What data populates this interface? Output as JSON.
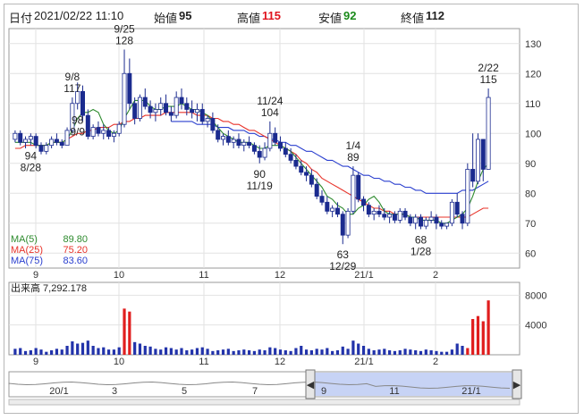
{
  "info": {
    "date_label": "日付",
    "date_value": "2021/02/22 11:10",
    "open_label": "始値",
    "open_value": "95",
    "high_label": "高値",
    "high_value": "115",
    "low_label": "安値",
    "low_value": "92",
    "close_label": "終値",
    "close_value": "112"
  },
  "colors": {
    "up": "#ffffff",
    "down": "#1b2b8f",
    "high": "#e0141e",
    "low": "#1a8a1a",
    "ma5": "#2e8b2e",
    "ma25": "#e8332a",
    "ma75": "#2a3fcf",
    "volume": "#2233aa",
    "volume_recent": "#e01e1e"
  },
  "legend": [
    {
      "name": "MA(5)",
      "value": "89.80",
      "color": "#2e8b2e"
    },
    {
      "name": "MA(25)",
      "value": "75.20",
      "color": "#e8332a"
    },
    {
      "name": "MA(75)",
      "value": "83.60",
      "color": "#2a3fcf"
    }
  ],
  "volume_label": "出来高",
  "volume_value": "7,292.178",
  "chart_data": [
    {
      "type": "candlestick",
      "y_ticks": [
        60,
        70,
        80,
        90,
        100,
        110,
        120,
        130
      ],
      "ylim": [
        55,
        135
      ],
      "x_ticks": [
        "9",
        "10",
        "11",
        "12",
        "21/1",
        "2"
      ],
      "annotations": [
        {
          "date": "8/28",
          "value": "94"
        },
        {
          "date": "9/8",
          "value": "117"
        },
        {
          "date": "9/9",
          "value": "98"
        },
        {
          "date": "9/25",
          "value": "128"
        },
        {
          "date": "11/24",
          "value": "104"
        },
        {
          "date": "11/19",
          "value": "90"
        },
        {
          "date": "1/4",
          "value": "89"
        },
        {
          "date": "12/29",
          "value": "63"
        },
        {
          "date": "1/28",
          "value": "68"
        },
        {
          "date": "2/22",
          "value": "115"
        }
      ],
      "ohlc": [
        [
          98,
          101,
          97,
          100
        ],
        [
          100,
          101,
          96,
          97
        ],
        [
          97,
          99,
          95,
          98
        ],
        [
          98,
          100,
          96,
          99
        ],
        [
          99,
          100,
          95,
          96
        ],
        [
          96,
          97,
          93,
          94
        ],
        [
          94,
          97,
          93,
          96
        ],
        [
          96,
          99,
          95,
          98
        ],
        [
          98,
          100,
          96,
          97
        ],
        [
          97,
          98,
          95,
          96
        ],
        [
          96,
          102,
          96,
          101
        ],
        [
          101,
          112,
          100,
          110
        ],
        [
          110,
          117,
          108,
          114
        ],
        [
          114,
          116,
          104,
          106
        ],
        [
          106,
          108,
          98,
          99
        ],
        [
          99,
          103,
          98,
          102
        ],
        [
          102,
          104,
          99,
          100
        ],
        [
          100,
          103,
          98,
          101
        ],
        [
          101,
          102,
          98,
          99
        ],
        [
          99,
          101,
          97,
          100
        ],
        [
          100,
          104,
          99,
          103
        ],
        [
          103,
          128,
          102,
          120
        ],
        [
          120,
          125,
          108,
          110
        ],
        [
          110,
          112,
          103,
          105
        ],
        [
          105,
          113,
          104,
          112
        ],
        [
          112,
          115,
          108,
          109
        ],
        [
          109,
          111,
          105,
          107
        ],
        [
          107,
          110,
          104,
          108
        ],
        [
          108,
          112,
          106,
          110
        ],
        [
          110,
          113,
          106,
          107
        ],
        [
          107,
          109,
          104,
          106
        ],
        [
          106,
          114,
          105,
          112
        ],
        [
          112,
          115,
          108,
          110
        ],
        [
          110,
          112,
          106,
          108
        ],
        [
          108,
          111,
          105,
          107
        ],
        [
          107,
          110,
          104,
          108
        ],
        [
          108,
          110,
          103,
          104
        ],
        [
          104,
          106,
          102,
          105
        ],
        [
          105,
          107,
          100,
          101
        ],
        [
          101,
          103,
          97,
          98
        ],
        [
          98,
          100,
          96,
          99
        ],
        [
          99,
          101,
          96,
          97
        ],
        [
          97,
          99,
          95,
          98
        ],
        [
          98,
          100,
          95,
          96
        ],
        [
          96,
          98,
          94,
          97
        ],
        [
          97,
          99,
          95,
          96
        ],
        [
          96,
          97,
          93,
          94
        ],
        [
          94,
          96,
          90,
          92
        ],
        [
          92,
          97,
          91,
          95
        ],
        [
          95,
          104,
          94,
          100
        ],
        [
          100,
          102,
          96,
          97
        ],
        [
          97,
          99,
          94,
          95
        ],
        [
          95,
          97,
          92,
          93
        ],
        [
          93,
          95,
          90,
          91
        ],
        [
          91,
          93,
          88,
          89
        ],
        [
          89,
          91,
          86,
          87
        ],
        [
          87,
          89,
          84,
          86
        ],
        [
          86,
          88,
          82,
          83
        ],
        [
          83,
          85,
          78,
          79
        ],
        [
          79,
          81,
          76,
          77
        ],
        [
          77,
          79,
          73,
          74
        ],
        [
          74,
          76,
          72,
          75
        ],
        [
          75,
          77,
          72,
          73
        ],
        [
          73,
          74,
          63,
          66
        ],
        [
          66,
          75,
          65,
          74
        ],
        [
          74,
          89,
          73,
          86
        ],
        [
          86,
          87,
          77,
          78
        ],
        [
          78,
          79,
          74,
          76
        ],
        [
          76,
          77,
          72,
          73
        ],
        [
          73,
          75,
          71,
          74
        ],
        [
          74,
          76,
          72,
          73
        ],
        [
          73,
          75,
          71,
          72
        ],
        [
          72,
          74,
          70,
          73
        ],
        [
          73,
          74,
          70,
          71
        ],
        [
          71,
          75,
          70,
          74
        ],
        [
          74,
          75,
          71,
          72
        ],
        [
          72,
          73,
          69,
          70
        ],
        [
          70,
          73,
          68,
          72
        ],
        [
          72,
          73,
          68,
          69
        ],
        [
          69,
          72,
          68,
          71
        ],
        [
          71,
          74,
          70,
          72
        ],
        [
          72,
          73,
          68,
          70
        ],
        [
          70,
          71,
          68,
          69
        ],
        [
          69,
          70,
          68,
          70
        ],
        [
          70,
          78,
          69,
          77
        ],
        [
          77,
          80,
          72,
          73
        ],
        [
          73,
          74,
          68,
          70
        ],
        [
          70,
          90,
          69,
          88
        ],
        [
          88,
          100,
          82,
          84
        ],
        [
          84,
          100,
          83,
          98
        ],
        [
          98,
          96,
          84,
          88
        ],
        [
          88,
          115,
          92,
          112
        ]
      ],
      "ma5": [
        97,
        97,
        97,
        97,
        96,
        96,
        96,
        97,
        97,
        97,
        98,
        101,
        105,
        107,
        107,
        108,
        107,
        103,
        101,
        100,
        101,
        105,
        108,
        111,
        111,
        111,
        109,
        108,
        108,
        109,
        109,
        109,
        110,
        109,
        108,
        108,
        107,
        106,
        104,
        102,
        100,
        99,
        98,
        97,
        97,
        97,
        96,
        95,
        95,
        96,
        96,
        96,
        95,
        94,
        92,
        90,
        88,
        86,
        84,
        82,
        79,
        78,
        76,
        75,
        73,
        73,
        75,
        76,
        78,
        79,
        77,
        74,
        73,
        73,
        73,
        73,
        72,
        72,
        71,
        71,
        71,
        71,
        70,
        70,
        71,
        72,
        73,
        75,
        79,
        84,
        88,
        90
      ],
      "ma25": [
        95,
        95,
        96,
        96,
        96,
        96,
        96,
        97,
        97,
        97,
        98,
        99,
        100,
        100,
        101,
        101,
        102,
        102,
        102,
        103,
        103,
        104,
        104,
        105,
        105,
        106,
        106,
        106,
        106,
        107,
        107,
        107,
        107,
        107,
        107,
        106,
        106,
        106,
        105,
        105,
        104,
        104,
        103,
        103,
        102,
        101,
        101,
        100,
        99,
        98,
        97,
        96,
        95,
        94,
        93,
        91,
        90,
        88,
        87,
        85,
        84,
        83,
        82,
        81,
        80,
        79,
        78,
        77,
        76,
        75,
        75,
        74,
        74,
        73,
        73,
        73,
        72,
        72,
        72,
        72,
        72,
        72,
        72,
        72,
        72,
        72,
        72,
        72,
        73,
        74,
        75,
        75
      ],
      "ma75": [
        null,
        null,
        null,
        null,
        null,
        null,
        null,
        null,
        null,
        null,
        null,
        null,
        null,
        null,
        null,
        null,
        null,
        null,
        null,
        null,
        null,
        null,
        null,
        null,
        null,
        null,
        null,
        null,
        null,
        null,
        104,
        104,
        104,
        104,
        104,
        103,
        103,
        103,
        103,
        102,
        102,
        102,
        101,
        101,
        101,
        100,
        100,
        99,
        99,
        98,
        98,
        97,
        97,
        96,
        96,
        95,
        94,
        94,
        93,
        92,
        91,
        91,
        90,
        89,
        89,
        88,
        87,
        86,
        86,
        85,
        85,
        84,
        84,
        83,
        83,
        82,
        82,
        81,
        81,
        80,
        80,
        80,
        80,
        80,
        80,
        80,
        81,
        81,
        81,
        82,
        83,
        84
      ],
      "volume": [
        800,
        900,
        500,
        600,
        900,
        700,
        400,
        600,
        800,
        700,
        1200,
        1800,
        1500,
        1600,
        1900,
        1200,
        900,
        1000,
        700,
        700,
        1000,
        6200,
        5800,
        1700,
        1500,
        1200,
        1100,
        800,
        700,
        1000,
        900,
        700,
        900,
        600,
        700,
        900,
        1000,
        800,
        500,
        600,
        700,
        800,
        500,
        600,
        700,
        600,
        500,
        700,
        600,
        1000,
        900,
        700,
        600,
        500,
        900,
        1200,
        700,
        600,
        800,
        700,
        900,
        500,
        600,
        1100,
        800,
        1900,
        1500,
        1200,
        800,
        600,
        700,
        800,
        600,
        500,
        600,
        800,
        700,
        600,
        500,
        700,
        600,
        500,
        400,
        400,
        700,
        1500,
        1200,
        900,
        4800,
        5200,
        4500,
        7300
      ],
      "volume_ticks": [
        4000,
        8000
      ],
      "volume_x_ticks": [
        "9",
        "10",
        "11",
        "12",
        "21/1",
        "2"
      ]
    }
  ],
  "navigator": {
    "labels": [
      "20/1",
      "3",
      "5",
      "7",
      "9",
      "11",
      "21/1"
    ],
    "left_handle": "◀",
    "right_handle": "▶"
  }
}
